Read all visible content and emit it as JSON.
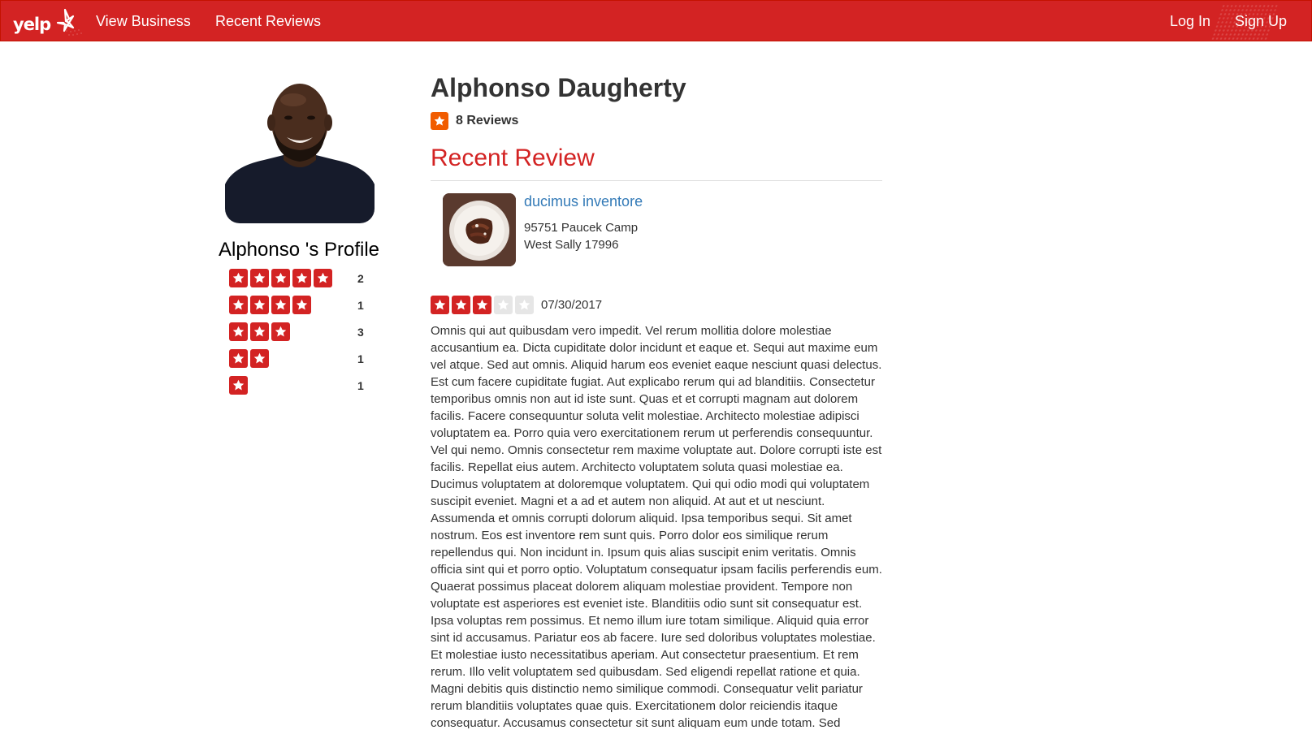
{
  "nav": {
    "logo": "yelp",
    "view_business": "View Business",
    "recent_reviews": "Recent Reviews",
    "log_in": "Log In",
    "sign_up": "Sign Up"
  },
  "profile": {
    "title": "Alphonso 's Profile",
    "distribution": [
      {
        "stars": 5,
        "count": "2"
      },
      {
        "stars": 4,
        "count": "1"
      },
      {
        "stars": 3,
        "count": "3"
      },
      {
        "stars": 2,
        "count": "1"
      },
      {
        "stars": 1,
        "count": "1"
      }
    ]
  },
  "user": {
    "name": "Alphonso Daugherty",
    "review_count": "8 Reviews"
  },
  "recent": {
    "section_title": "Recent Review",
    "business_name": "ducimus inventore",
    "address_line1": "95751 Paucek Camp",
    "address_line2": "West Sally 17996",
    "rating": 3,
    "max_rating": 5,
    "date": "07/30/2017",
    "text": "Omnis qui aut quibusdam vero impedit. Vel rerum mollitia dolore molestiae accusantium ea. Dicta cupiditate dolor incidunt et eaque et. Sequi aut maxime eum vel atque. Sed aut omnis. Aliquid harum eos eveniet eaque nesciunt quasi delectus. Est cum facere cupiditate fugiat. Aut explicabo rerum qui ad blanditiis. Consectetur temporibus omnis non aut id iste sunt. Quas et et corrupti magnam aut dolorem facilis. Facere consequuntur soluta velit molestiae. Architecto molestiae adipisci voluptatem ea. Porro quia vero exercitationem rerum ut perferendis consequuntur. Vel qui nemo. Omnis consectetur rem maxime voluptate aut. Dolore corrupti iste est facilis. Repellat eius autem. Architecto voluptatem soluta quasi molestiae ea. Ducimus voluptatem at doloremque voluptatem. Qui qui odio modi qui voluptatem suscipit eveniet. Magni et a ad et autem non aliquid. At aut et ut nesciunt. Assumenda et omnis corrupti dolorum aliquid. Ipsa temporibus sequi. Sit amet nostrum. Eos est inventore rem sunt quis. Porro dolor eos similique rerum repellendus qui. Non incidunt in. Ipsum quis alias suscipit enim veritatis. Omnis officia sint qui et porro optio. Voluptatum consequatur ipsam facilis perferendis eum. Quaerat possimus placeat dolorem aliquam molestiae provident. Tempore non voluptate est asperiores est eveniet iste. Blanditiis odio sunt sit consequatur est. Ipsa voluptas rem possimus. Et nemo illum iure totam similique. Aliquid quia error sint id accusamus. Pariatur eos ab facere. Iure sed doloribus voluptates molestiae. Et molestiae iusto necessitatibus aperiam. Aut consectetur praesentium. Et rem rerum. Illo velit voluptatem sed quibusdam. Sed eligendi repellat ratione et quia. Magni debitis quis distinctio nemo similique commodi. Consequatur velit pariatur rerum blanditiis voluptates quae quis. Exercitationem dolor reiciendis itaque consequatur. Accusamus consectetur sit sunt aliquam eum unde totam. Sed"
  },
  "colors": {
    "brand": "#d32323",
    "star_off": "#e6e6e6",
    "review_icon": "#f15c00",
    "link": "#337ab7"
  }
}
